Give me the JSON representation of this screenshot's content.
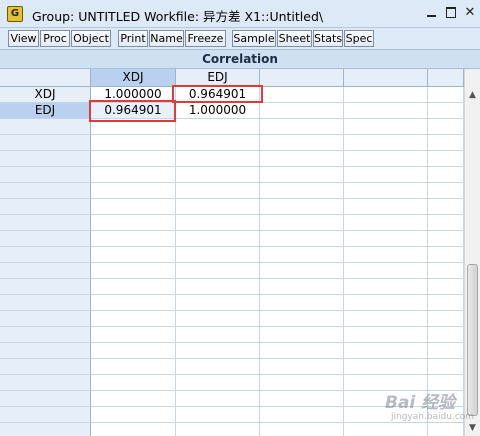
{
  "window": {
    "icon_letter": "G",
    "title": "Group: UNTITLED   Workfile: 异方差 X1::Untitled\\",
    "min_glyph": "_",
    "close_glyph": "✕"
  },
  "toolbar": {
    "buttons": [
      "View",
      "Proc",
      "Object",
      "Print",
      "Name",
      "Freeze",
      "Sample",
      "Sheet",
      "Stats",
      "Spec"
    ]
  },
  "table": {
    "title": "Correlation",
    "columns": [
      "XDJ",
      "EDJ"
    ],
    "rows": [
      {
        "label": "XDJ",
        "cells": [
          "1.000000",
          "0.964901"
        ]
      },
      {
        "label": "EDJ",
        "cells": [
          "0.964901",
          "1.000000"
        ]
      }
    ],
    "selected_row": "EDJ",
    "selected_column": "XDJ"
  },
  "scrollbar": {
    "up_glyph": "▲",
    "down_glyph": "▼"
  },
  "watermark": {
    "brand": "Bai 经验",
    "url": "jingyan.baidu.com"
  },
  "colors": {
    "highlight": "#e23a3a",
    "header_bg": "#e6eef8",
    "selected_bg": "#b9d1ee"
  }
}
